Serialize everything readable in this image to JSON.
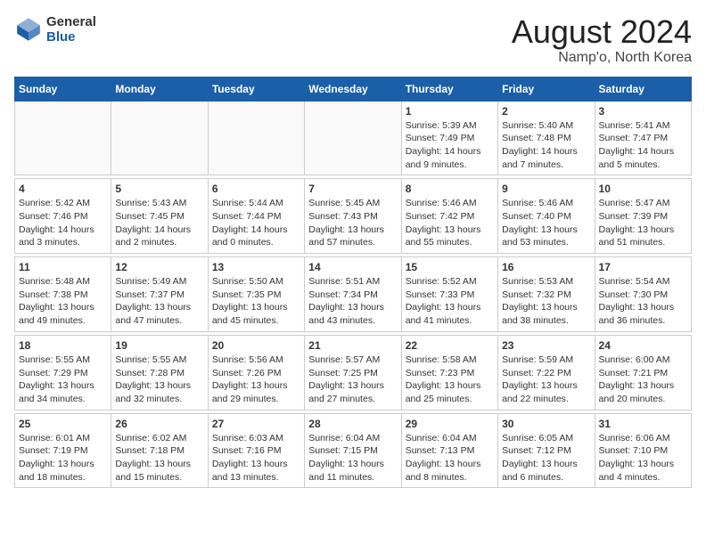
{
  "header": {
    "logo_general": "General",
    "logo_blue": "Blue",
    "month_year": "August 2024",
    "location": "Namp'o, North Korea"
  },
  "weekdays": [
    "Sunday",
    "Monday",
    "Tuesday",
    "Wednesday",
    "Thursday",
    "Friday",
    "Saturday"
  ],
  "weeks": [
    [
      {
        "day": "",
        "info": ""
      },
      {
        "day": "",
        "info": ""
      },
      {
        "day": "",
        "info": ""
      },
      {
        "day": "",
        "info": ""
      },
      {
        "day": "1",
        "info": "Sunrise: 5:39 AM\nSunset: 7:49 PM\nDaylight: 14 hours\nand 9 minutes."
      },
      {
        "day": "2",
        "info": "Sunrise: 5:40 AM\nSunset: 7:48 PM\nDaylight: 14 hours\nand 7 minutes."
      },
      {
        "day": "3",
        "info": "Sunrise: 5:41 AM\nSunset: 7:47 PM\nDaylight: 14 hours\nand 5 minutes."
      }
    ],
    [
      {
        "day": "4",
        "info": "Sunrise: 5:42 AM\nSunset: 7:46 PM\nDaylight: 14 hours\nand 3 minutes."
      },
      {
        "day": "5",
        "info": "Sunrise: 5:43 AM\nSunset: 7:45 PM\nDaylight: 14 hours\nand 2 minutes."
      },
      {
        "day": "6",
        "info": "Sunrise: 5:44 AM\nSunset: 7:44 PM\nDaylight: 14 hours\nand 0 minutes."
      },
      {
        "day": "7",
        "info": "Sunrise: 5:45 AM\nSunset: 7:43 PM\nDaylight: 13 hours\nand 57 minutes."
      },
      {
        "day": "8",
        "info": "Sunrise: 5:46 AM\nSunset: 7:42 PM\nDaylight: 13 hours\nand 55 minutes."
      },
      {
        "day": "9",
        "info": "Sunrise: 5:46 AM\nSunset: 7:40 PM\nDaylight: 13 hours\nand 53 minutes."
      },
      {
        "day": "10",
        "info": "Sunrise: 5:47 AM\nSunset: 7:39 PM\nDaylight: 13 hours\nand 51 minutes."
      }
    ],
    [
      {
        "day": "11",
        "info": "Sunrise: 5:48 AM\nSunset: 7:38 PM\nDaylight: 13 hours\nand 49 minutes."
      },
      {
        "day": "12",
        "info": "Sunrise: 5:49 AM\nSunset: 7:37 PM\nDaylight: 13 hours\nand 47 minutes."
      },
      {
        "day": "13",
        "info": "Sunrise: 5:50 AM\nSunset: 7:35 PM\nDaylight: 13 hours\nand 45 minutes."
      },
      {
        "day": "14",
        "info": "Sunrise: 5:51 AM\nSunset: 7:34 PM\nDaylight: 13 hours\nand 43 minutes."
      },
      {
        "day": "15",
        "info": "Sunrise: 5:52 AM\nSunset: 7:33 PM\nDaylight: 13 hours\nand 41 minutes."
      },
      {
        "day": "16",
        "info": "Sunrise: 5:53 AM\nSunset: 7:32 PM\nDaylight: 13 hours\nand 38 minutes."
      },
      {
        "day": "17",
        "info": "Sunrise: 5:54 AM\nSunset: 7:30 PM\nDaylight: 13 hours\nand 36 minutes."
      }
    ],
    [
      {
        "day": "18",
        "info": "Sunrise: 5:55 AM\nSunset: 7:29 PM\nDaylight: 13 hours\nand 34 minutes."
      },
      {
        "day": "19",
        "info": "Sunrise: 5:55 AM\nSunset: 7:28 PM\nDaylight: 13 hours\nand 32 minutes."
      },
      {
        "day": "20",
        "info": "Sunrise: 5:56 AM\nSunset: 7:26 PM\nDaylight: 13 hours\nand 29 minutes."
      },
      {
        "day": "21",
        "info": "Sunrise: 5:57 AM\nSunset: 7:25 PM\nDaylight: 13 hours\nand 27 minutes."
      },
      {
        "day": "22",
        "info": "Sunrise: 5:58 AM\nSunset: 7:23 PM\nDaylight: 13 hours\nand 25 minutes."
      },
      {
        "day": "23",
        "info": "Sunrise: 5:59 AM\nSunset: 7:22 PM\nDaylight: 13 hours\nand 22 minutes."
      },
      {
        "day": "24",
        "info": "Sunrise: 6:00 AM\nSunset: 7:21 PM\nDaylight: 13 hours\nand 20 minutes."
      }
    ],
    [
      {
        "day": "25",
        "info": "Sunrise: 6:01 AM\nSunset: 7:19 PM\nDaylight: 13 hours\nand 18 minutes."
      },
      {
        "day": "26",
        "info": "Sunrise: 6:02 AM\nSunset: 7:18 PM\nDaylight: 13 hours\nand 15 minutes."
      },
      {
        "day": "27",
        "info": "Sunrise: 6:03 AM\nSunset: 7:16 PM\nDaylight: 13 hours\nand 13 minutes."
      },
      {
        "day": "28",
        "info": "Sunrise: 6:04 AM\nSunset: 7:15 PM\nDaylight: 13 hours\nand 11 minutes."
      },
      {
        "day": "29",
        "info": "Sunrise: 6:04 AM\nSunset: 7:13 PM\nDaylight: 13 hours\nand 8 minutes."
      },
      {
        "day": "30",
        "info": "Sunrise: 6:05 AM\nSunset: 7:12 PM\nDaylight: 13 hours\nand 6 minutes."
      },
      {
        "day": "31",
        "info": "Sunrise: 6:06 AM\nSunset: 7:10 PM\nDaylight: 13 hours\nand 4 minutes."
      }
    ]
  ]
}
